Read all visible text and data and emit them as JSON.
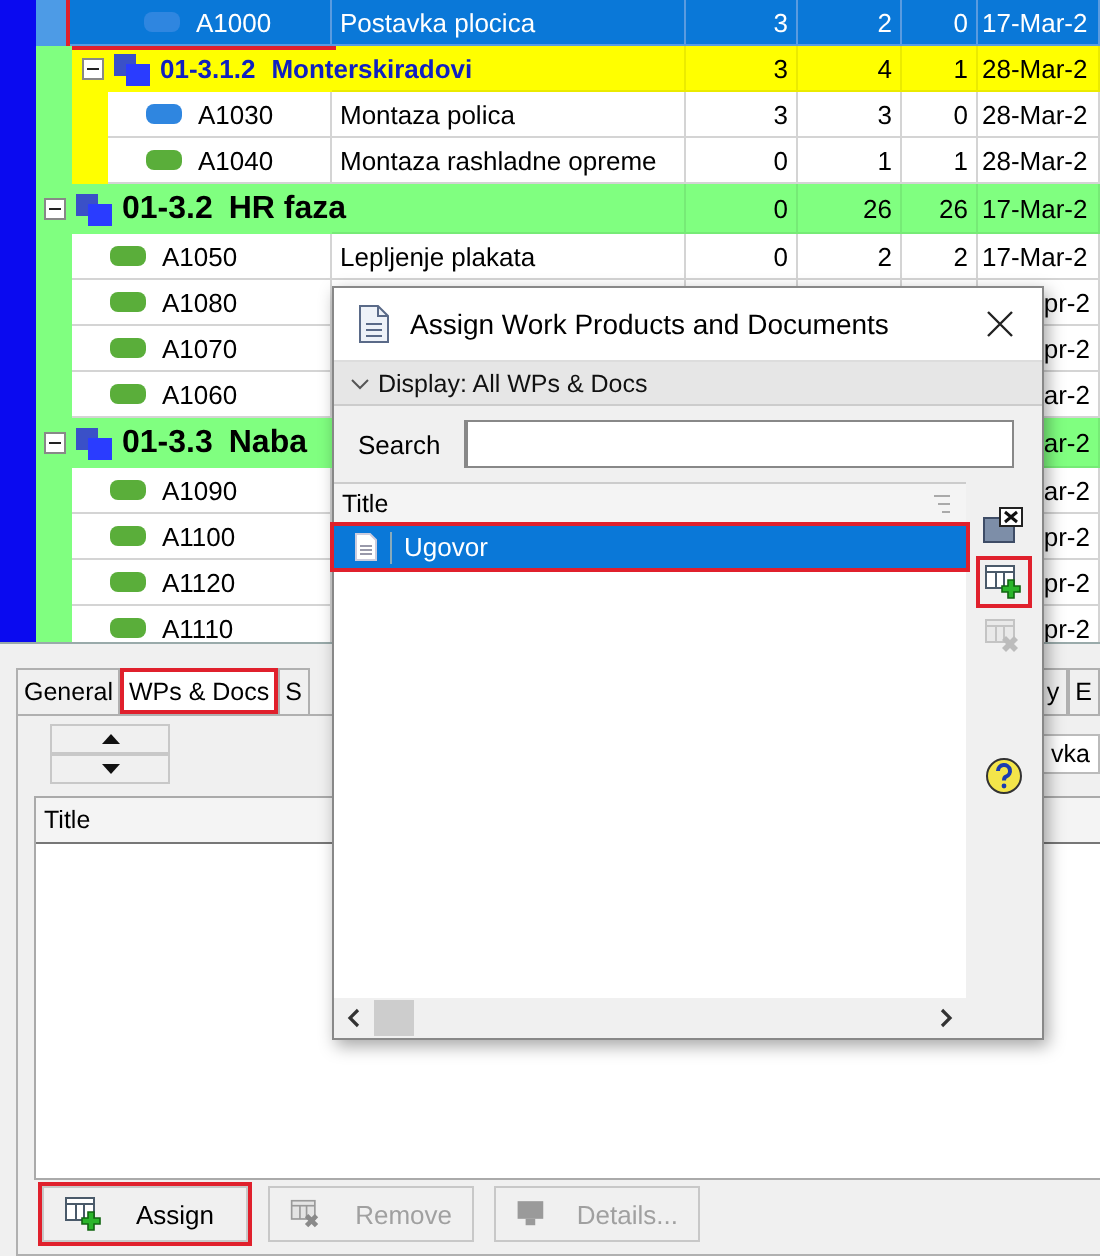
{
  "grid": {
    "rows": [
      {
        "kind": "task",
        "selected": true,
        "highlighted": true,
        "color": "#2f86e0",
        "id": "A1000",
        "title": "Postavka plocica",
        "col_1": "3",
        "col_2": "2",
        "col_3": "0",
        "date": "17-Mar-2"
      },
      {
        "kind": "subgroup",
        "expanded": true,
        "color": "#ffff00",
        "code": "01-3.1.2",
        "name": "Monterskiradovi",
        "col_1": "3",
        "col_2": "4",
        "col_3": "1",
        "date": "28-Mar-2",
        "children": [
          {
            "kind": "task",
            "selected": false,
            "color": "#2f86e0",
            "id": "A1030",
            "title": "Montaza polica",
            "col_1": "3",
            "col_2": "3",
            "col_3": "0",
            "date": "28-Mar-2"
          },
          {
            "kind": "task",
            "selected": false,
            "color": "#5aae3a",
            "id": "A1040",
            "title": "Montaza rashladne opreme",
            "col_1": "0",
            "col_2": "1",
            "col_3": "1",
            "date": "28-Mar-2"
          }
        ]
      },
      {
        "kind": "group",
        "expanded": true,
        "color": "#80ff80",
        "code": "01-3.2",
        "name": "HR faza",
        "col_1": "0",
        "col_2": "26",
        "col_3": "26",
        "date": "17-Mar-2",
        "children": [
          {
            "kind": "task",
            "selected": false,
            "color": "#5aae3a",
            "id": "A1050",
            "title": "Lepljenje plakata",
            "col_1": "0",
            "col_2": "2",
            "col_3": "2",
            "date": "17-Mar-2"
          },
          {
            "kind": "task",
            "selected": false,
            "color": "#5aae3a",
            "id": "A1080",
            "date": "pr-2"
          },
          {
            "kind": "task",
            "selected": false,
            "color": "#5aae3a",
            "id": "A1070",
            "date": "pr-2"
          },
          {
            "kind": "task",
            "selected": false,
            "color": "#5aae3a",
            "id": "A1060",
            "date": "ar-2"
          }
        ]
      },
      {
        "kind": "group",
        "expanded": true,
        "color": "#80ff80",
        "code": "01-3.3",
        "name": "Naba",
        "date": "ar-2",
        "children": [
          {
            "kind": "task",
            "selected": false,
            "color": "#5aae3a",
            "id": "A1090",
            "date": "ar-2"
          },
          {
            "kind": "task",
            "selected": false,
            "color": "#5aae3a",
            "id": "A1100",
            "date": "pr-2"
          },
          {
            "kind": "task",
            "selected": false,
            "color": "#5aae3a",
            "id": "A1120",
            "date": "pr-2"
          },
          {
            "kind": "task",
            "selected": false,
            "color": "#5aae3a",
            "id": "A1110",
            "date": "pr-2"
          }
        ]
      }
    ]
  },
  "details_panel": {
    "tabs": [
      {
        "label": "General",
        "selected": false
      },
      {
        "label": "WPs & Docs",
        "selected": true,
        "highlighted": true
      },
      {
        "label": "S",
        "selected": false
      }
    ],
    "tabs_right": [
      {
        "label": "y",
        "selected": false
      },
      {
        "label": "E",
        "selected": false
      }
    ],
    "field_value": "vka",
    "table": {
      "columns": [
        "Title"
      ]
    },
    "buttons": [
      {
        "kind": "assign",
        "label": "Assign",
        "disabled": false,
        "highlighted": true
      },
      {
        "kind": "remove",
        "label": "Remove",
        "disabled": true,
        "highlighted": false
      },
      {
        "kind": "details",
        "label": "Details...",
        "disabled": true,
        "highlighted": false
      }
    ]
  },
  "dialog": {
    "title": "Assign Work Products and Documents",
    "display_filter": "Display: All WPs & Docs",
    "search": {
      "label": "Search"
    },
    "list": {
      "columns": [
        "Title"
      ],
      "rows": [
        {
          "title": "Ugovor",
          "selected": true,
          "highlighted": true
        }
      ]
    },
    "toolbar": [
      {
        "kind": "close-view",
        "disabled": false,
        "highlighted": false
      },
      {
        "kind": "add",
        "disabled": false,
        "highlighted": true
      },
      {
        "kind": "remove",
        "disabled": true,
        "highlighted": false
      },
      {
        "kind": "help",
        "disabled": false,
        "highlighted": false
      }
    ]
  }
}
